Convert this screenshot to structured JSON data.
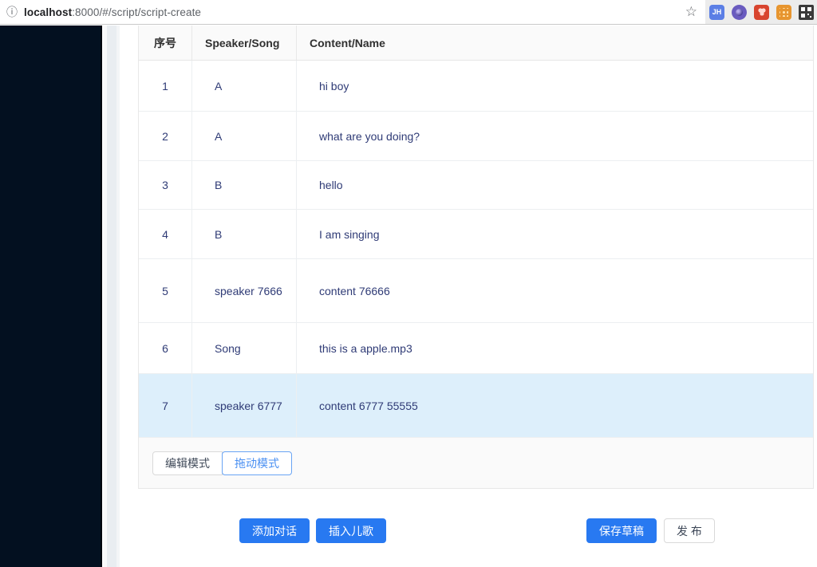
{
  "browser": {
    "url_host": "localhost",
    "url_rest": ":8000/#/script/script-create",
    "info_icon": "page-info-icon",
    "star_icon": "bookmark-star-icon",
    "extensions": [
      {
        "name": "jh-extension-icon",
        "label": "JH",
        "color": "#5b7ee5"
      },
      {
        "name": "purple-circle-extension-icon",
        "label": "",
        "color": "#6a5bbf"
      },
      {
        "name": "red-extension-icon",
        "label": "",
        "color": "#d8442e"
      },
      {
        "name": "orange-dots-extension-icon",
        "label": "",
        "color": "#e7952f"
      },
      {
        "name": "qr-code-extension-icon",
        "label": "",
        "color": "#3a3a3a"
      }
    ]
  },
  "table": {
    "columns": [
      "序号",
      "Speaker/Song",
      "Content/Name"
    ],
    "rows": [
      {
        "index": "1",
        "speaker": "A",
        "content": "hi boy",
        "highlighted": false
      },
      {
        "index": "2",
        "speaker": "A",
        "content": "what are you doing?",
        "highlighted": false
      },
      {
        "index": "3",
        "speaker": "B",
        "content": "hello",
        "highlighted": false
      },
      {
        "index": "4",
        "speaker": "B",
        "content": "I am singing",
        "highlighted": false
      },
      {
        "index": "5",
        "speaker": "speaker 7666",
        "content": "content 76666",
        "highlighted": false
      },
      {
        "index": "6",
        "speaker": "Song",
        "content": "this is a apple.mp3",
        "highlighted": false
      },
      {
        "index": "7",
        "speaker": "speaker 6777",
        "content": "content 6777 55555",
        "highlighted": true
      }
    ]
  },
  "mode_toggle": {
    "edit_label": "编辑模式",
    "drag_label": "拖动模式",
    "selected": "拖动模式"
  },
  "actions": {
    "add_dialog_label": "添加对话",
    "insert_song_label": "插入儿歌",
    "save_draft_label": "保存草稿",
    "publish_label": "发 布"
  },
  "colors": {
    "primary_blue": "#2879f1",
    "cell_text": "#2f3b76",
    "row_highlight": "#ddeffb",
    "sidebar_dark": "#031020",
    "table_header_bg": "#fafafa",
    "selected_radio_blue": "#4a90f2"
  }
}
